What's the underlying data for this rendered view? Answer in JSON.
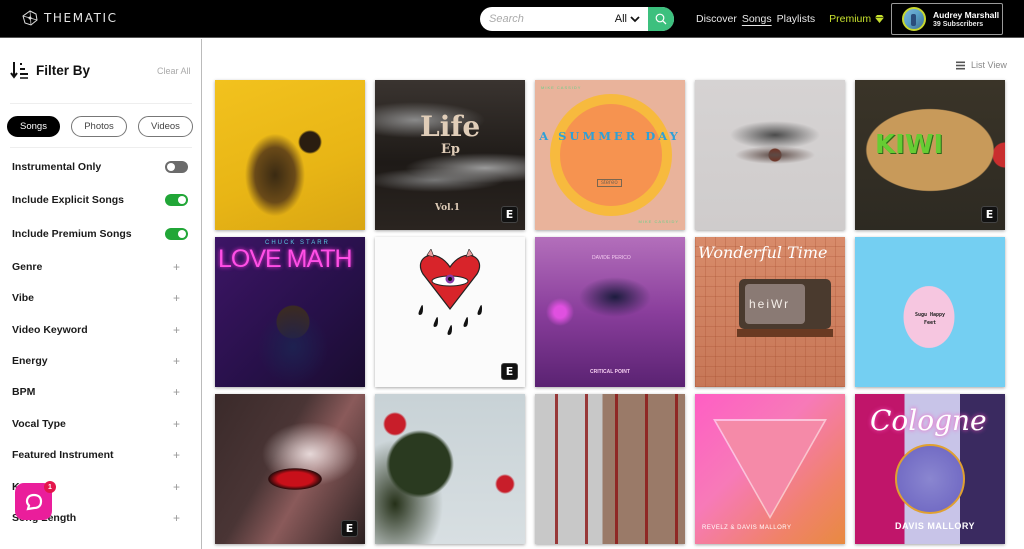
{
  "header": {
    "logo_text": "THEMATIC",
    "search": {
      "placeholder": "Search",
      "value": "",
      "scope": "All"
    },
    "nav": [
      {
        "label": "Discover",
        "active": false
      },
      {
        "label": "Songs",
        "active": true
      },
      {
        "label": "Playlists",
        "active": false
      }
    ],
    "premium_label": "Premium",
    "user": {
      "name": "Audrey Marshall",
      "subscribers": "39 Subscribers"
    }
  },
  "sidebar": {
    "title": "Filter By",
    "clear_all": "Clear All",
    "media_tabs": [
      {
        "label": "Songs",
        "active": true
      },
      {
        "label": "Photos",
        "active": false
      },
      {
        "label": "Videos",
        "active": false
      }
    ],
    "toggles": [
      {
        "label": "Instrumental Only",
        "on": false
      },
      {
        "label": "Include Explicit Songs",
        "on": true
      },
      {
        "label": "Include Premium Songs",
        "on": true
      }
    ],
    "filters": [
      "Genre",
      "Vibe",
      "Video Keyword",
      "Energy",
      "BPM",
      "Vocal Type",
      "Featured Instrument",
      "Key",
      "Song Length"
    ]
  },
  "chat_widget": {
    "badge_count": "1"
  },
  "main": {
    "list_view_label": "List View",
    "explicit_badge": "E",
    "albums": [
      {
        "title": "",
        "explicit": false
      },
      {
        "title": "Life",
        "subtitle": "Ep",
        "extra": "Vol.1",
        "explicit": true
      },
      {
        "title": "A SUMMER DAY",
        "subtitle": "stereo",
        "extra": "MIKE CASSIDY",
        "explicit": false
      },
      {
        "title": "",
        "explicit": false
      },
      {
        "title": "KIWI",
        "explicit": true
      },
      {
        "title": "LOVE MATH",
        "subtitle": "CHUCK STARR",
        "explicit": false
      },
      {
        "title": "",
        "explicit": true
      },
      {
        "title": "CRITICAL POINT",
        "subtitle": "DAVIDE PERICO",
        "explicit": false
      },
      {
        "title": "Wonderful Time",
        "subtitle": "heiWr",
        "explicit": false
      },
      {
        "title": "Sugu Happy Feet",
        "explicit": false
      },
      {
        "title": "",
        "explicit": true
      },
      {
        "title": "",
        "explicit": false
      },
      {
        "title": "",
        "explicit": false
      },
      {
        "title": "REVELZ & DAVIS MALLORY",
        "explicit": false
      },
      {
        "title": "Cologne",
        "subtitle": "DAVIS MALLORY",
        "explicit": false
      }
    ]
  }
}
